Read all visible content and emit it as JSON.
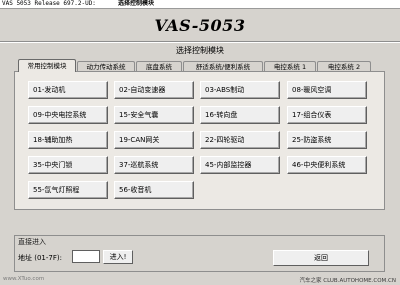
{
  "titlebar": {
    "text": "VAS 5053 Release 697.2-UD:",
    "title": "选择控制模块"
  },
  "header": {
    "product": "VAS-5053"
  },
  "heading": "选择控制模块",
  "tabs": [
    {
      "label": "常用控制模块",
      "active": true
    },
    {
      "label": "动力传动系统",
      "active": false
    },
    {
      "label": "底盘系统",
      "active": false
    },
    {
      "label": "舒适系统/便利系统",
      "active": false
    },
    {
      "label": "电控系统 1",
      "active": false
    },
    {
      "label": "电控系统 2",
      "active": false
    }
  ],
  "modules": [
    "01-发动机",
    "02-自动变速器",
    "03-ABS制动",
    "08-暖风空调",
    "09-中央电控系统",
    "15-安全气囊",
    "16-转向盘",
    "17-组合仪表",
    "18-辅助加热",
    "19-CAN网关",
    "22-四轮驱动",
    "25-防盗系统",
    "35-中央门锁",
    "37-巡航系统",
    "45-内部监控器",
    "46-中央便利系统",
    "55-氙气灯照程",
    "56-收音机"
  ],
  "direct_entry": {
    "title": "直接进入",
    "address_label": "地址 (01-7F):",
    "address_value": "",
    "enter_label": "进入!"
  },
  "back_label": "返回",
  "watermark": {
    "left": "www.XTuo.com",
    "right": "汽车之家 CLUB.AUTOHOME.COM.CN"
  }
}
